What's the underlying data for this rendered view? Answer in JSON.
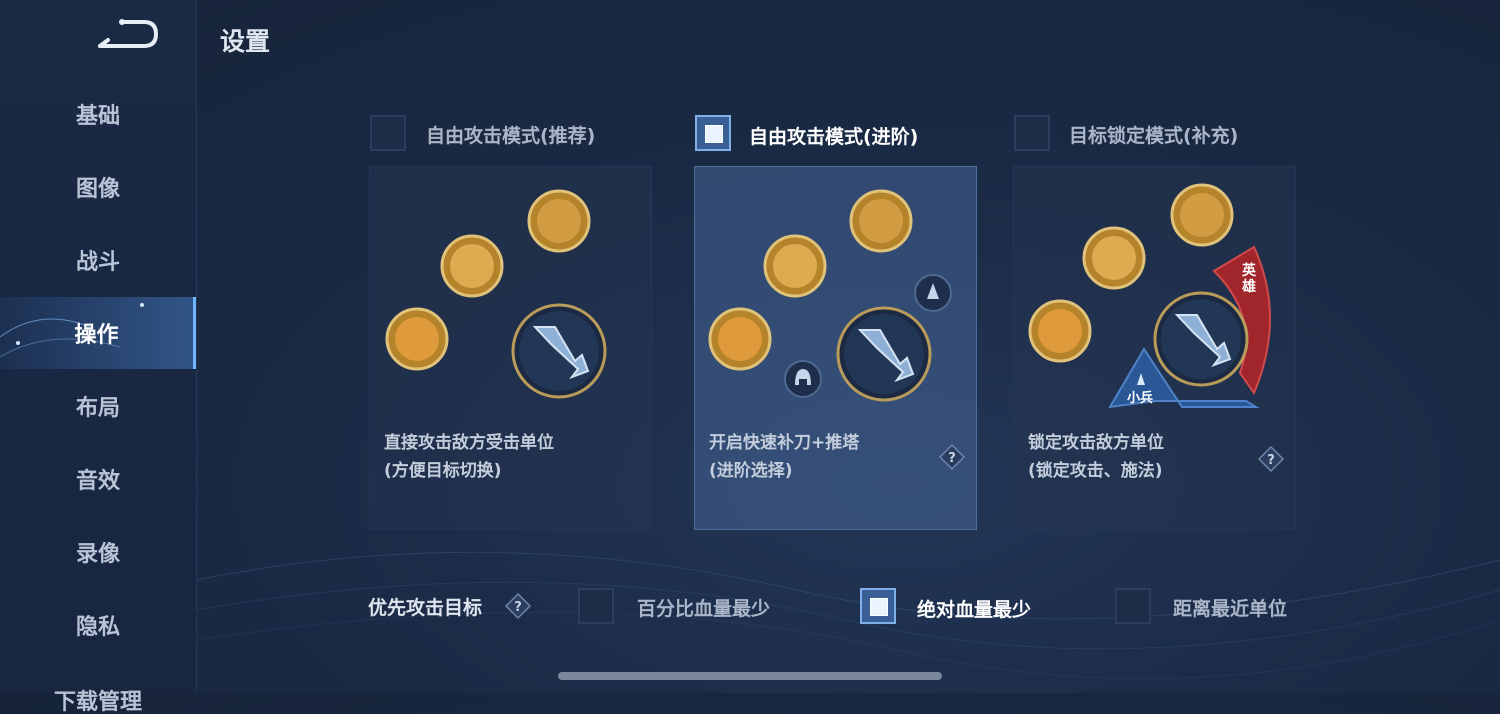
{
  "page": {
    "title": "设置"
  },
  "sidebar": {
    "items": [
      {
        "label": "基础"
      },
      {
        "label": "图像"
      },
      {
        "label": "战斗"
      },
      {
        "label": "操作",
        "active": true
      },
      {
        "label": "布局"
      },
      {
        "label": "音效"
      },
      {
        "label": "录像"
      },
      {
        "label": "隐私"
      },
      {
        "label": "下载管理"
      }
    ]
  },
  "modes": [
    {
      "label": "自由攻击模式(推荐)",
      "checked": false,
      "desc_line1": "直接攻击敌方受击单位",
      "desc_line2": "(方便目标切换)"
    },
    {
      "label": "自由攻击模式(进阶)",
      "checked": true,
      "desc_line1": "开启快速补刀+推塔",
      "desc_line2": "(进阶选择)"
    },
    {
      "label": "目标锁定模式(补充)",
      "checked": false,
      "desc_line1": "锁定攻击敌方单位",
      "desc_line2": "(锁定攻击、施法)"
    }
  ],
  "card_tags": {
    "hero_line1": "英",
    "hero_line2": "雄",
    "minion": "小兵"
  },
  "priority": {
    "label": "优先攻击目标",
    "options": [
      {
        "label": "百分比血量最少",
        "checked": false
      },
      {
        "label": "绝对血量最少",
        "checked": true
      },
      {
        "label": "距离最近单位",
        "checked": false
      }
    ]
  },
  "icons": {
    "back": "back-arrow-icon",
    "help": "question-diamond-icon",
    "attack": "sword-icon",
    "skill": "skill-icon",
    "tower": "tower-icon",
    "minion": "helmet-icon"
  },
  "colors": {
    "accent": "#6fb6ff",
    "hero_tag": "#a0262c",
    "minion_tag": "#2a5896"
  }
}
